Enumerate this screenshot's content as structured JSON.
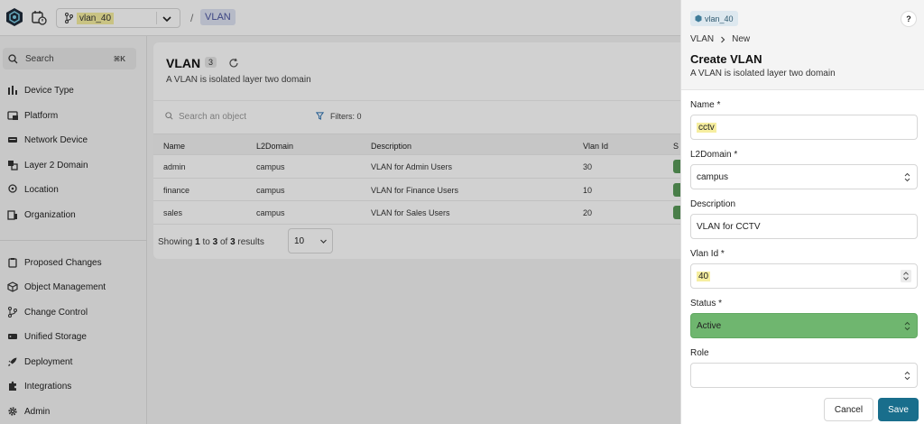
{
  "topbar": {
    "branch_name": "vlan_40",
    "breadcrumb_sep": "/",
    "breadcrumb_current": "VLAN"
  },
  "sidebar": {
    "search_label": "Search",
    "search_shortcut": "⌘K",
    "top_items": [
      {
        "label": "Device Type",
        "icon": "bar-chart-icon"
      },
      {
        "label": "Platform",
        "icon": "platform-icon"
      },
      {
        "label": "Network Device",
        "icon": "network-device-icon"
      },
      {
        "label": "Layer 2 Domain",
        "icon": "layers-icon"
      },
      {
        "label": "Location",
        "icon": "location-pin-icon"
      },
      {
        "label": "Organization",
        "icon": "building-icon"
      }
    ],
    "bottom_items": [
      {
        "label": "Proposed Changes",
        "icon": "clipboard-icon"
      },
      {
        "label": "Object Management",
        "icon": "cube-icon"
      },
      {
        "label": "Change Control",
        "icon": "git-branch-icon"
      },
      {
        "label": "Unified Storage",
        "icon": "storage-icon"
      },
      {
        "label": "Deployment",
        "icon": "rocket-icon"
      },
      {
        "label": "Integrations",
        "icon": "puzzle-icon"
      },
      {
        "label": "Admin",
        "icon": "gear-icon"
      }
    ]
  },
  "list": {
    "title": "VLAN",
    "count": "3",
    "subtitle": "A VLAN is isolated layer two domain",
    "search_placeholder": "Search an object",
    "filters_label": "Filters: 0",
    "columns": [
      "Name",
      "L2Domain",
      "Description",
      "Vlan Id",
      "S"
    ],
    "rows": [
      {
        "name": "admin",
        "l2domain": "campus",
        "description": "VLAN for Admin Users",
        "vlan_id": "30"
      },
      {
        "name": "finance",
        "l2domain": "campus",
        "description": "VLAN for Finance Users",
        "vlan_id": "10"
      },
      {
        "name": "sales",
        "l2domain": "campus",
        "description": "VLAN for Sales Users",
        "vlan_id": "20"
      }
    ],
    "paging_prefix": "Showing ",
    "paging_from": "1",
    "paging_mid": " to ",
    "paging_to": "3",
    "paging_of": " of ",
    "paging_total": "3",
    "paging_suffix": " results",
    "page_size": "10"
  },
  "drawer": {
    "branch_name": "vlan_40",
    "help_label": "?",
    "crumb_parent": "VLAN",
    "crumb_current": "New",
    "title": "Create VLAN",
    "subtitle": "A VLAN is isolated layer two domain",
    "fields": {
      "name_label": "Name *",
      "name_value": "cctv",
      "l2domain_label": "L2Domain *",
      "l2domain_value": "campus",
      "description_label": "Description",
      "description_value": "VLAN for CCTV",
      "vlan_id_label": "Vlan Id *",
      "vlan_id_value": "40",
      "status_label": "Status *",
      "status_value": "Active",
      "role_label": "Role",
      "role_value": ""
    },
    "cancel_label": "Cancel",
    "save_label": "Save"
  },
  "colors": {
    "accent": "#196e8c",
    "status_active": "#6fb66f",
    "highlight": "#f6eea0"
  }
}
